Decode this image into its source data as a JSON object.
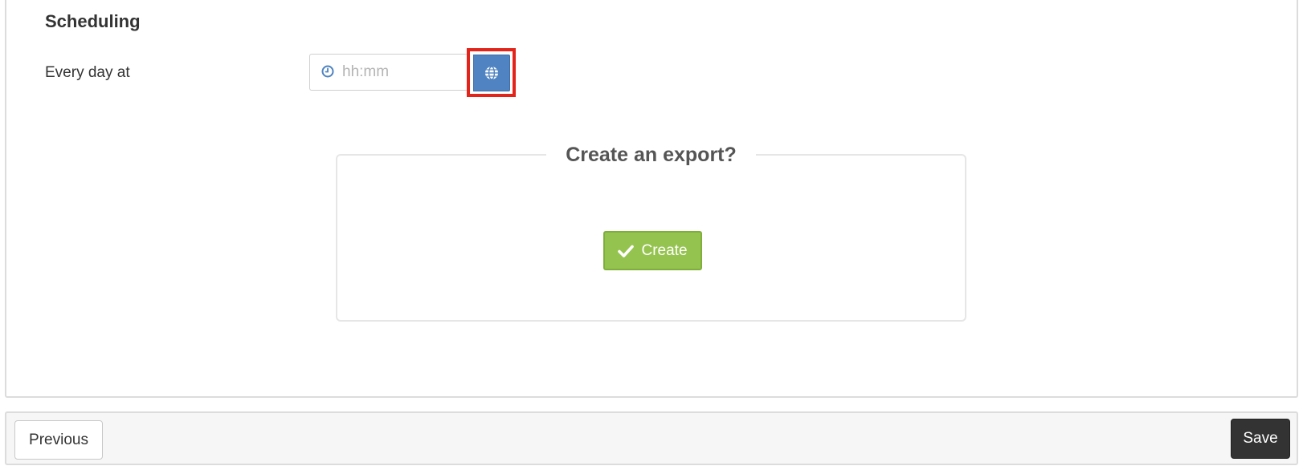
{
  "scheduling": {
    "title": "Scheduling",
    "every_day_label": "Every day at",
    "time_input": {
      "value": "",
      "placeholder": "hh:mm",
      "icon": "clock-icon"
    },
    "timezone_button": {
      "icon": "globe-icon",
      "highlighted": true,
      "color": "#4f83c1",
      "highlight_color": "#e3241b"
    }
  },
  "export": {
    "legend": "Create an export?",
    "create_button": {
      "label": "Create",
      "icon": "check-icon",
      "color": "#95c34f"
    }
  },
  "footer": {
    "previous_label": "Previous",
    "save_label": "Save",
    "save_color": "#333333"
  }
}
